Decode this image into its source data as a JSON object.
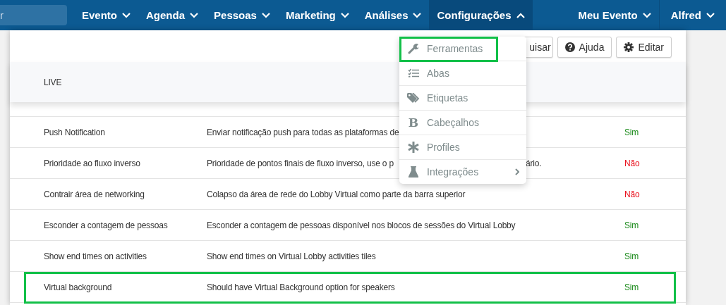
{
  "nav": {
    "search": {
      "placeholder": "r"
    },
    "items": [
      {
        "label": "Evento",
        "expanded": false
      },
      {
        "label": "Agenda",
        "expanded": false
      },
      {
        "label": "Pessoas",
        "expanded": false
      },
      {
        "label": "Marketing",
        "expanded": false
      },
      {
        "label": "Análises",
        "expanded": false
      },
      {
        "label": "Configurações",
        "expanded": true
      }
    ],
    "right_items": [
      {
        "label": "Meu Evento",
        "expanded": false
      },
      {
        "label": "Alfred",
        "expanded": false
      }
    ]
  },
  "toolbar": {
    "buttons": [
      {
        "label": "uisar"
      },
      {
        "label": "Ajuda"
      },
      {
        "label": "Editar"
      }
    ]
  },
  "table": {
    "header": "LIVE",
    "rows": [
      {
        "name": "Push Notification",
        "description": "Enviar notificação push para todas as plataformas de",
        "value": "Sim",
        "kind": "yes",
        "outlined": false
      },
      {
        "name": "Prioridade ao fluxo inverso",
        "description": "Prioridade de pontos finais de fluxo inverso, use o p",
        "description_end": "ário.",
        "value": "Não",
        "kind": "no",
        "outlined": false
      },
      {
        "name": "Contrair área de networking",
        "description": "Colapso da área de rede do Lobby Virtual como parte da barra superior",
        "value": "Não",
        "kind": "no",
        "outlined": false
      },
      {
        "name": "Esconder a contagem de pessoas",
        "description": "Esconder a contagem de pessoas disponível nos blocos de sessões do Virtual Lobby",
        "value": "Sim",
        "kind": "yes",
        "outlined": false
      },
      {
        "name": "Show end times on activities",
        "description": "Show end times on Virtual Lobby activities tiles",
        "value": "Sim",
        "kind": "yes",
        "outlined": false
      },
      {
        "name": "Virtual background",
        "description": "Should have Virtual Background option for speakers",
        "value": "Sim",
        "kind": "yes",
        "outlined": true
      }
    ]
  },
  "menu": {
    "items": [
      {
        "label": "Ferramentas",
        "outlined": true,
        "submenu": false
      },
      {
        "label": "Abas",
        "outlined": false,
        "submenu": false
      },
      {
        "label": "Etiquetas",
        "outlined": false,
        "submenu": false
      },
      {
        "label": "Cabeçalhos",
        "glyph": "B",
        "outlined": false,
        "submenu": false
      },
      {
        "label": "Profiles",
        "outlined": false,
        "submenu": false
      },
      {
        "label": "Integrações",
        "outlined": false,
        "submenu": true
      }
    ]
  }
}
